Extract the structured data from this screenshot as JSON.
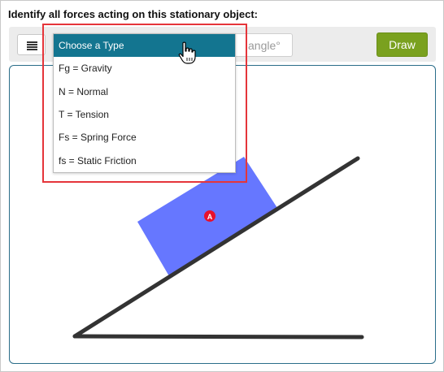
{
  "question": {
    "prompt": "Identify all forces acting on this stationary object:"
  },
  "toolbar": {
    "menu_icon": "list-icon",
    "angle_placeholder": "angle°",
    "draw_label": "Draw"
  },
  "force_dropdown": {
    "options": [
      {
        "label": "Choose a Type",
        "selected": true
      },
      {
        "label": "Fg = Gravity",
        "selected": false
      },
      {
        "label": "N = Normal",
        "selected": false
      },
      {
        "label": "T = Tension",
        "selected": false
      },
      {
        "label": "Fs = Spring Force",
        "selected": false
      },
      {
        "label": "fs = Static Friction",
        "selected": false
      }
    ]
  },
  "diagram": {
    "point_label": "A"
  },
  "colors": {
    "accent_teal": "#137590",
    "draw_green": "#7aa11f",
    "block_blue": "#6677ff",
    "point_red": "#e8112d",
    "highlight_red": "#e5353a",
    "canvas_border": "#2a6d89"
  }
}
